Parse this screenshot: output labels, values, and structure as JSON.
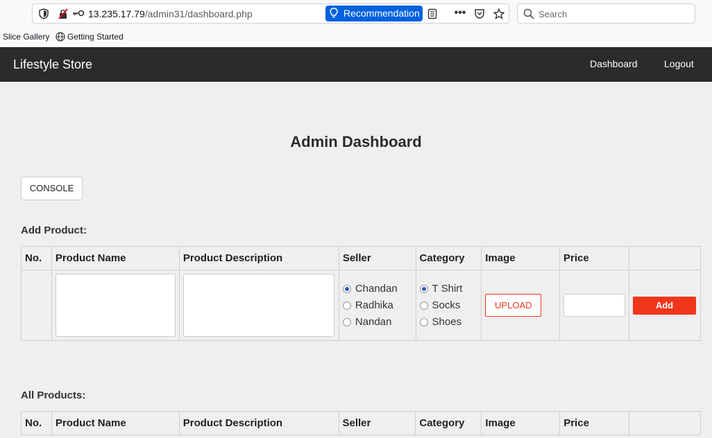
{
  "browser": {
    "url_host": "13.235.17.79",
    "url_path": "/admin31/dashboard.php",
    "recommendation_label": "Recommendation",
    "search_placeholder": "Search",
    "bookmarks": [
      {
        "label": "Slice Gallery"
      },
      {
        "label": "Getting Started"
      }
    ]
  },
  "navbar": {
    "brand": "Lifestyle Store",
    "links": [
      {
        "label": "Dashboard"
      },
      {
        "label": "Logout"
      }
    ]
  },
  "page": {
    "title": "Admin Dashboard",
    "console_label": "CONSOLE"
  },
  "add_product": {
    "section_label": "Add Product:",
    "columns": [
      "No.",
      "Product Name",
      "Product Description",
      "Seller",
      "Category",
      "Image",
      "Price",
      ""
    ],
    "sellers": [
      {
        "label": "Chandan",
        "checked": true
      },
      {
        "label": "Radhika",
        "checked": false
      },
      {
        "label": "Nandan",
        "checked": false
      }
    ],
    "categories": [
      {
        "label": "T Shirt",
        "checked": true
      },
      {
        "label": "Socks",
        "checked": false
      },
      {
        "label": "Shoes",
        "checked": false
      }
    ],
    "upload_label": "UPLOAD",
    "add_label": "Add"
  },
  "all_products": {
    "section_label": "All Products:",
    "columns": [
      "No.",
      "Product Name",
      "Product Description",
      "Seller",
      "Category",
      "Image",
      "Price",
      ""
    ]
  },
  "colors": {
    "navbar_bg": "#2b2b2b",
    "accent_red": "#f0371c",
    "browser_blue": "#0061e0"
  }
}
